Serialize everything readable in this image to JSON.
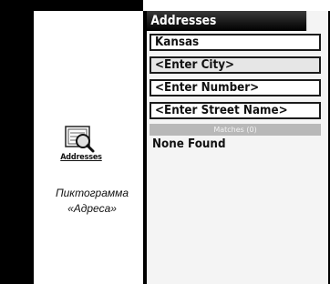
{
  "side_icon": {
    "icon": "address-book-magnifier-icon",
    "label": "Addresses"
  },
  "caption": {
    "line1": "Пиктограмма",
    "line2": "«Адреса»"
  },
  "device": {
    "title": "Addresses",
    "fields": {
      "state": "Kansas",
      "city": "<Enter City>",
      "number": "<Enter Number>",
      "street": "<Enter Street Name>"
    },
    "matches_label": "Matches (0)",
    "result_text": "None Found"
  }
}
